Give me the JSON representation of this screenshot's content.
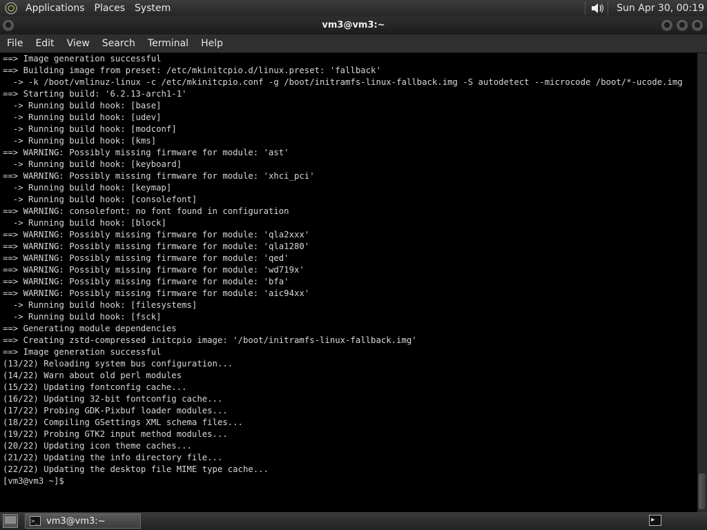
{
  "top_panel": {
    "menus": [
      "Applications",
      "Places",
      "System"
    ],
    "clock": "Sun Apr 30, 00:19"
  },
  "window": {
    "title": "vm3@vm3:~"
  },
  "menubar": {
    "items": [
      "File",
      "Edit",
      "View",
      "Search",
      "Terminal",
      "Help"
    ]
  },
  "terminal": {
    "lines": [
      "==> Image generation successful",
      "==> Building image from preset: /etc/mkinitcpio.d/linux.preset: 'fallback'",
      "  -> -k /boot/vmlinuz-linux -c /etc/mkinitcpio.conf -g /boot/initramfs-linux-fallback.img -S autodetect --microcode /boot/*-ucode.img",
      "==> Starting build: '6.2.13-arch1-1'",
      "  -> Running build hook: [base]",
      "  -> Running build hook: [udev]",
      "  -> Running build hook: [modconf]",
      "  -> Running build hook: [kms]",
      "==> WARNING: Possibly missing firmware for module: 'ast'",
      "  -> Running build hook: [keyboard]",
      "==> WARNING: Possibly missing firmware for module: 'xhci_pci'",
      "  -> Running build hook: [keymap]",
      "  -> Running build hook: [consolefont]",
      "==> WARNING: consolefont: no font found in configuration",
      "  -> Running build hook: [block]",
      "==> WARNING: Possibly missing firmware for module: 'qla2xxx'",
      "==> WARNING: Possibly missing firmware for module: 'qla1280'",
      "==> WARNING: Possibly missing firmware for module: 'qed'",
      "==> WARNING: Possibly missing firmware for module: 'wd719x'",
      "==> WARNING: Possibly missing firmware for module: 'bfa'",
      "==> WARNING: Possibly missing firmware for module: 'aic94xx'",
      "  -> Running build hook: [filesystems]",
      "  -> Running build hook: [fsck]",
      "==> Generating module dependencies",
      "==> Creating zstd-compressed initcpio image: '/boot/initramfs-linux-fallback.img'",
      "==> Image generation successful",
      "(13/22) Reloading system bus configuration...",
      "(14/22) Warn about old perl modules",
      "(15/22) Updating fontconfig cache...",
      "(16/22) Updating 32-bit fontconfig cache...",
      "(17/22) Probing GDK-Pixbuf loader modules...",
      "(18/22) Compiling GSettings XML schema files...",
      "(19/22) Probing GTK2 input method modules...",
      "(20/22) Updating icon theme caches...",
      "(21/22) Updating the info directory file...",
      "(22/22) Updating the desktop file MIME type cache...",
      "[vm3@vm3 ~]$ "
    ]
  },
  "taskbar": {
    "task_label": "vm3@vm3:~"
  },
  "icons": {
    "logo": "gnome-foot-icon",
    "volume": "volume-icon",
    "close": "close-icon",
    "maximize": "maximize-icon",
    "minimize": "minimize-icon",
    "menu": "window-menu-icon",
    "show_desktop": "show-desktop-icon",
    "terminal": "terminal-icon"
  }
}
